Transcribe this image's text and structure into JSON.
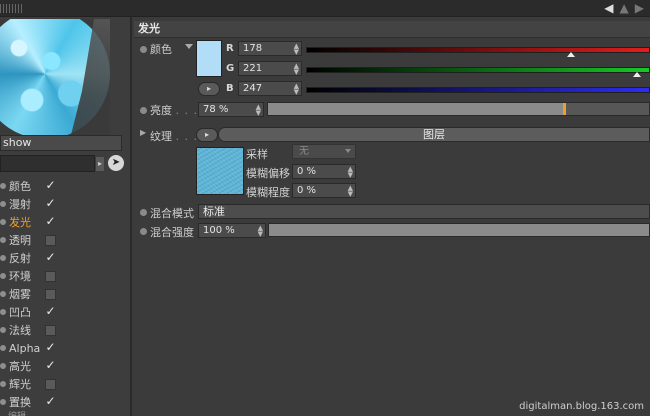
{
  "left": {
    "material_name": "show",
    "channels": [
      {
        "label": "颜色",
        "checked": true,
        "active": false
      },
      {
        "label": "漫射",
        "checked": true,
        "active": false
      },
      {
        "label": "发光",
        "checked": true,
        "active": true
      },
      {
        "label": "透明",
        "checked": false,
        "active": false
      },
      {
        "label": "反射",
        "checked": true,
        "active": false
      },
      {
        "label": "环境",
        "checked": false,
        "active": false
      },
      {
        "label": "烟雾",
        "checked": false,
        "active": false
      },
      {
        "label": "凹凸",
        "checked": true,
        "active": false
      },
      {
        "label": "法线",
        "checked": false,
        "active": false
      },
      {
        "label": "Alpha",
        "checked": true,
        "active": false
      },
      {
        "label": "高光",
        "checked": true,
        "active": false
      },
      {
        "label": "辉光",
        "checked": false,
        "active": false
      },
      {
        "label": "置换",
        "checked": true,
        "active": false
      }
    ],
    "bottom_label": "编辑"
  },
  "panel": {
    "title": "发光",
    "color_label": "颜色",
    "swatch_color": "#b2ddf7",
    "r_label": "R",
    "r_value": "178",
    "g_label": "G",
    "g_value": "221",
    "b_label": "B",
    "b_value": "247",
    "brightness_label": "亮度",
    "brightness_dots": ". . .",
    "brightness_value": "78 %",
    "brightness_fraction": 0.78,
    "texture_label": "纹理",
    "texture_dots": ". . .",
    "layer_button": "图层",
    "sampling_label": "采样",
    "sampling_value": "无",
    "blur_offset_label": "模糊偏移",
    "blur_offset_value": "0 %",
    "blur_scale_label": "模糊程度",
    "blur_scale_value": "0 %",
    "mix_mode_label": "混合模式",
    "mix_mode_value": "标准",
    "mix_strength_label": "混合强度",
    "mix_strength_value": "100 %"
  },
  "watermark": "digitalman.blog.163.com"
}
